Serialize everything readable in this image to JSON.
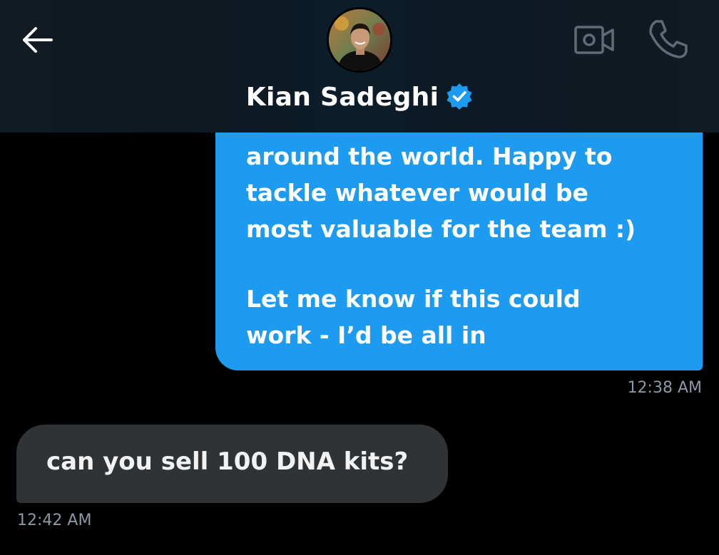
{
  "header": {
    "contact_name": "Kian Sadeghi",
    "verified": true,
    "icons": {
      "back": "arrow-left-icon",
      "video": "video-camera-icon",
      "phone": "phone-icon",
      "verified": "verified-badge-icon"
    }
  },
  "messages": [
    {
      "direction": "outgoing",
      "lines": [
        "around the world. Happy to",
        "tackle whatever would be",
        "most valuable for the team :)",
        "",
        "Let me know if this could",
        "work - I’d be all in"
      ],
      "time": "12:38 AM"
    },
    {
      "direction": "incoming",
      "text": "can you sell 100 DNA kits?",
      "time": "12:42 AM"
    }
  ],
  "colors": {
    "outgoing_bubble": "#1d9bf0",
    "incoming_bubble": "#303336",
    "background": "#000000",
    "timestamp": "#8b98a5",
    "verified_badge": "#1d9bf0"
  }
}
